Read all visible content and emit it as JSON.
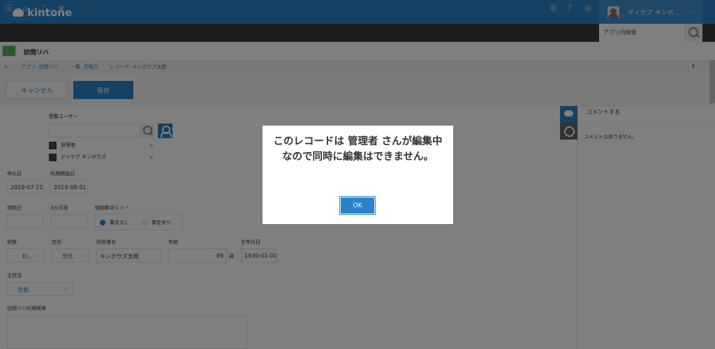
{
  "header": {
    "brand": "kintone",
    "user_name": "デイケア キンボ…",
    "search_placeholder": "アプリ内検索"
  },
  "app": {
    "title": "訪問リハ"
  },
  "breadcrumb": {
    "app_link": "アプリ: 訪問リハ",
    "view_link": "一覧: 月曜日",
    "record": "レコード: キンボウズ太郎"
  },
  "actions": {
    "cancel": "キャンセル",
    "save": "保存"
  },
  "form": {
    "viewer_label": "閲覧ユーザー",
    "viewers": [
      {
        "name": "管理者",
        "remove": "×"
      },
      {
        "name": "デイケア キンボウズ",
        "remove": "×"
      }
    ],
    "apply_date": {
      "label": "申込日",
      "value": "2019-07-21"
    },
    "start_date": {
      "label": "利用開始日",
      "value": "2019-08-01"
    },
    "leave_date": {
      "label": "退院日",
      "value": ""
    },
    "three_months": {
      "label": "3か月後",
      "value": ""
    },
    "short_term": {
      "label": "短期集中リハ",
      "required_mark": "*",
      "options": [
        "算定なし",
        "算定あり"
      ],
      "selected": "算定なし"
    },
    "status": {
      "label": "状態",
      "value": "利…"
    },
    "gender": {
      "label": "性別",
      "value": "男性"
    },
    "user_name": {
      "label": "利用者名",
      "value": "キンボウズ太郎"
    },
    "age": {
      "label": "年齢",
      "value": "89",
      "unit": "歳"
    },
    "birthdate": {
      "label": "生年月日",
      "value": "1930-01-01"
    },
    "lead": {
      "label": "主担当",
      "value": "京都"
    },
    "history_label": "訪問リハ利用経緯"
  },
  "comments": {
    "title": "コメントする",
    "empty": "コメントはありません。"
  },
  "dialog": {
    "message": "このレコードは 管理者 さんが編集中なので同時に編集はできません。",
    "ok": "OK"
  },
  "colors": {
    "brand_blue": "#2a82c8",
    "nav_dark": "#3b3b3b",
    "overlay": "rgba(0,0,0,0.5)"
  }
}
